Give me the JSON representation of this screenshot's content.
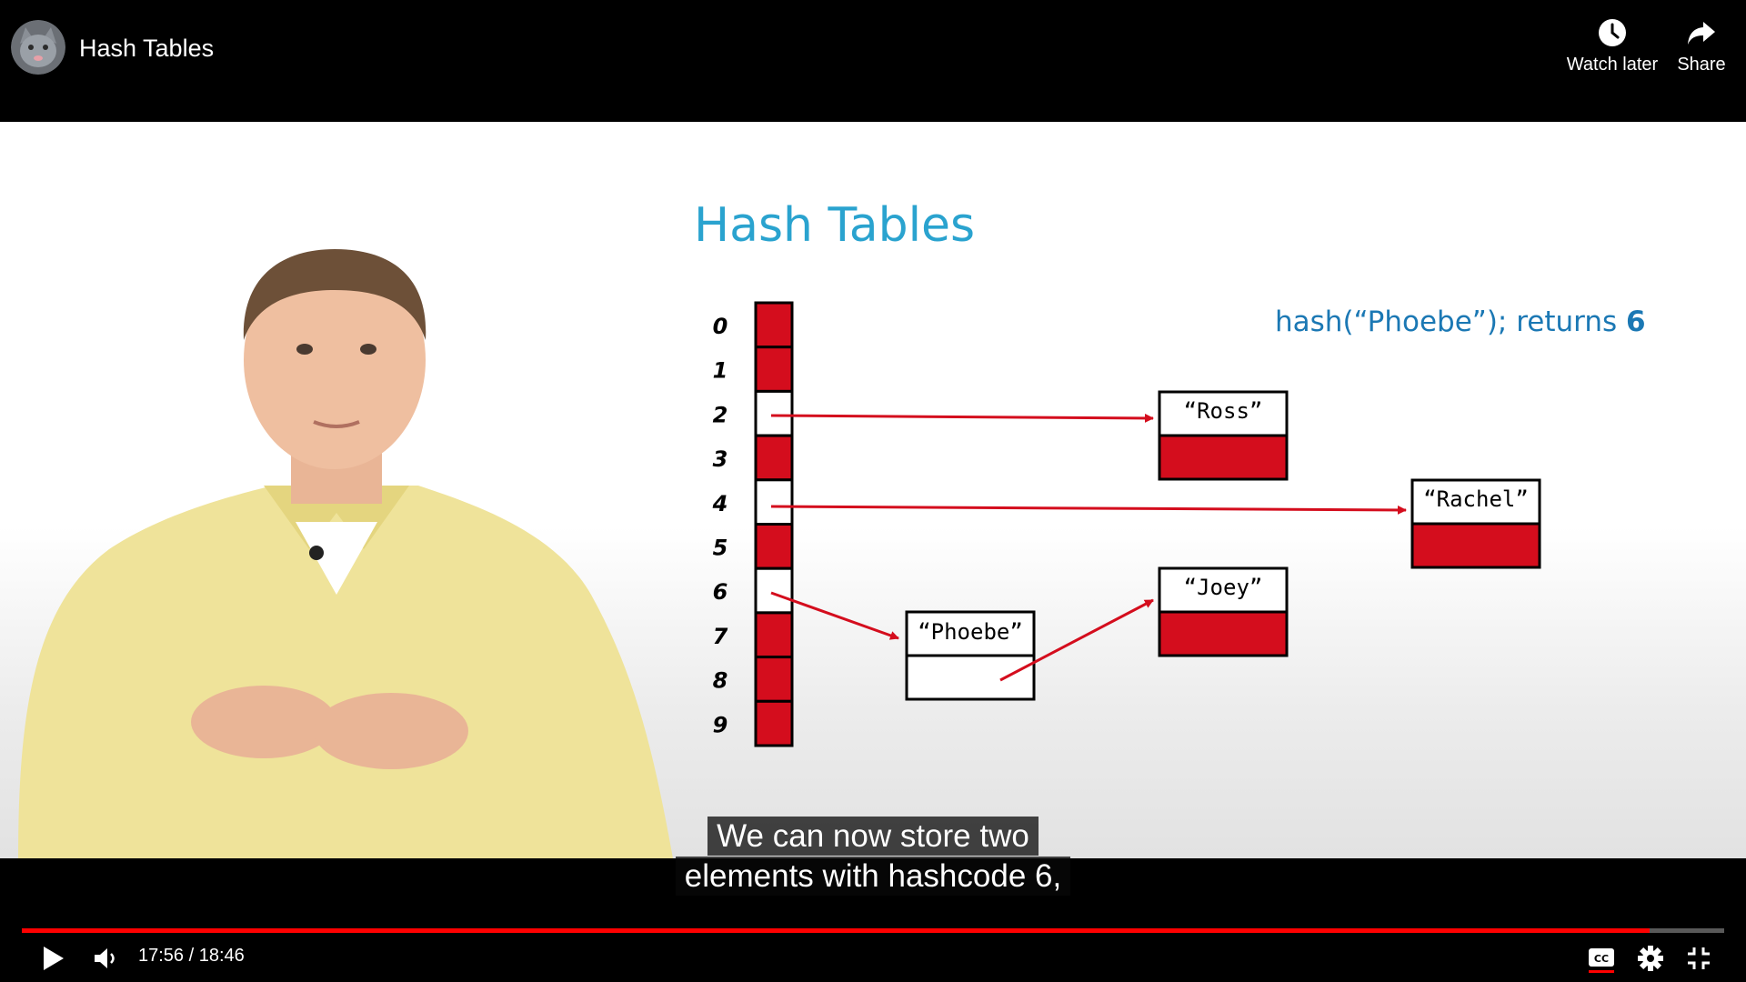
{
  "header": {
    "title": "Hash Tables",
    "avatar_icon": "cat-avatar-icon",
    "watch_later_label": "Watch later",
    "share_label": "Share"
  },
  "slide": {
    "title": "Hash Tables",
    "hash_call": "hash(“Phoebe”); returns ",
    "hash_result": "6",
    "indices": [
      "0",
      "1",
      "2",
      "3",
      "4",
      "5",
      "6",
      "7",
      "8",
      "9"
    ],
    "buckets": [
      "red",
      "red",
      "white",
      "red",
      "white",
      "red",
      "white",
      "red",
      "red",
      "red"
    ],
    "nodes": {
      "ross": "“Ross”",
      "rachel": "“Rachel”",
      "joey": "“Joey”",
      "phoebe": "“Phoebe”"
    },
    "accent_red": "#d40d1d",
    "title_color": "#2aa3cf"
  },
  "captions": {
    "line1": "We can now store two",
    "line2": "elements with hashcode 6,"
  },
  "player": {
    "current_time": "17:56",
    "duration": "18:46",
    "time_text": "17:56 / 18:46",
    "progress_fraction": 0.956,
    "progress_color": "#ff0000"
  }
}
